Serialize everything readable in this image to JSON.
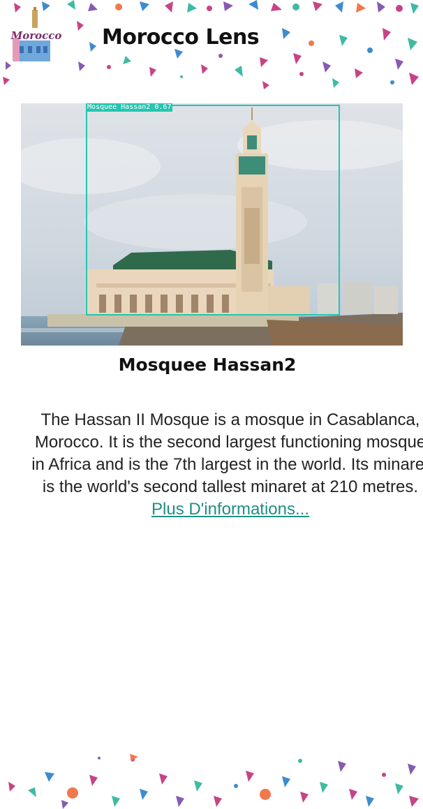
{
  "header": {
    "logo_text": "Morocco",
    "app_title": "Morocco Lens"
  },
  "detection": {
    "label": "Mosquee Hassan2 0.67",
    "class_name": "Mosquee Hassan2",
    "confidence": 0.67,
    "box_color": "#25c5b0"
  },
  "result": {
    "title": "Mosquee Hassan2",
    "description": "The Hassan II Mosque is a mosque in Casablanca, Morocco. It is the second largest functioning mosque in Africa and is the 7th largest in the world. Its minaret is the world's second tallest minaret at 210 metres.",
    "more_link": "Plus D'informations..."
  },
  "colors": {
    "accent": "#25c5b0",
    "link": "#1e8f85",
    "pattern_pink": "#c0307a",
    "pattern_blue": "#2a7fc8",
    "pattern_teal": "#2bb39a",
    "pattern_orange": "#f06a3a",
    "pattern_purple": "#7a4aa8"
  }
}
